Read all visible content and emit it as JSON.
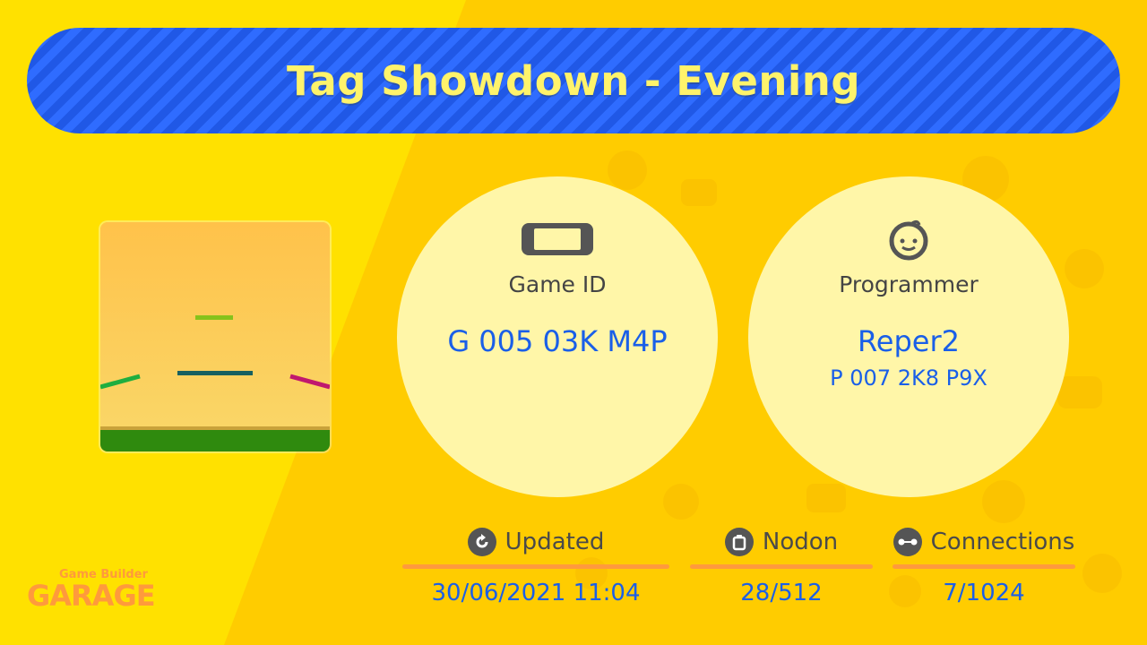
{
  "title": "Tag Showdown - Evening",
  "game_id": {
    "label": "Game ID",
    "value": "G 005 03K M4P",
    "icon": "handheld-console-icon"
  },
  "programmer": {
    "label": "Programmer",
    "name": "Reper2",
    "id": "P 007 2K8 P9X",
    "icon": "smiling-face-icon"
  },
  "stats": {
    "updated": {
      "label": "Updated",
      "value": "30/06/2021 11:04",
      "icon": "refresh-icon"
    },
    "nodon": {
      "label": "Nodon",
      "value": "28/512",
      "icon": "clipboard-icon"
    },
    "connections": {
      "label": "Connections",
      "value": "7/1024",
      "icon": "link-icon"
    }
  },
  "logo": {
    "line1": "Game Builder",
    "line2": "GARAGE"
  },
  "colors": {
    "background": "#ffe100",
    "banner": "#2f6cff",
    "title_text": "#fff36b",
    "value_text": "#1a5fe8",
    "accent_bar": "#ff9a3c",
    "circle": "#fff6a8"
  }
}
